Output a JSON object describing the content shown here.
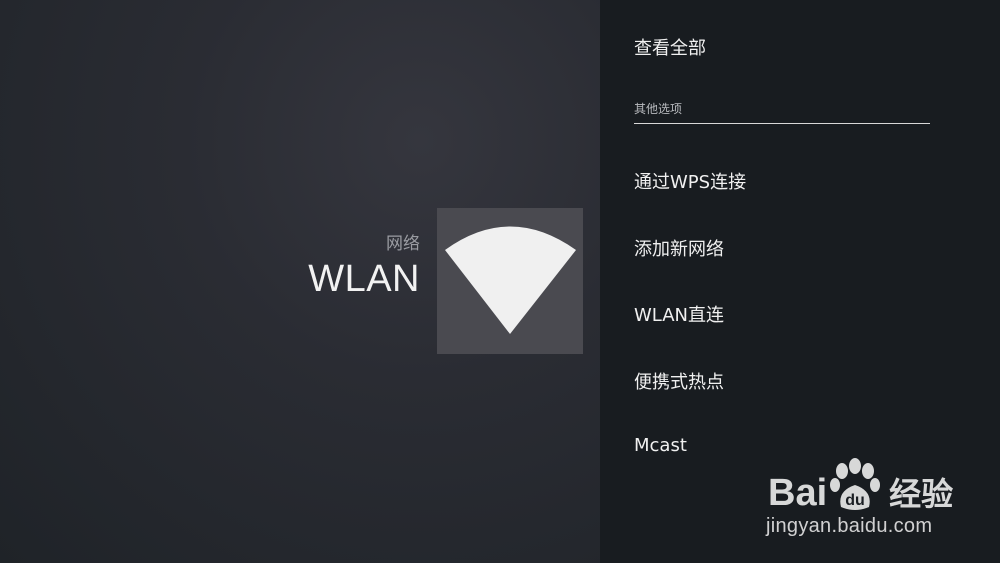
{
  "header": {
    "breadcrumb": "网络",
    "title": "WLAN",
    "icon": "wifi-icon"
  },
  "menu": {
    "view_all": "查看全部",
    "other_options_label": "其他选项",
    "items": [
      {
        "label": "通过WPS连接"
      },
      {
        "label": "添加新网络"
      },
      {
        "label": "WLAN直连"
      },
      {
        "label": "便携式热点"
      },
      {
        "label": "Mcast"
      }
    ]
  },
  "watermark": {
    "brand": "Bai",
    "brand_suffix": "经验",
    "url": "jingyan.baidu.com"
  },
  "colors": {
    "left_bg": "#2a2c33",
    "right_bg": "#181c20",
    "icon_tile": "#4a4a50",
    "icon_fill": "#f0f0f0"
  }
}
